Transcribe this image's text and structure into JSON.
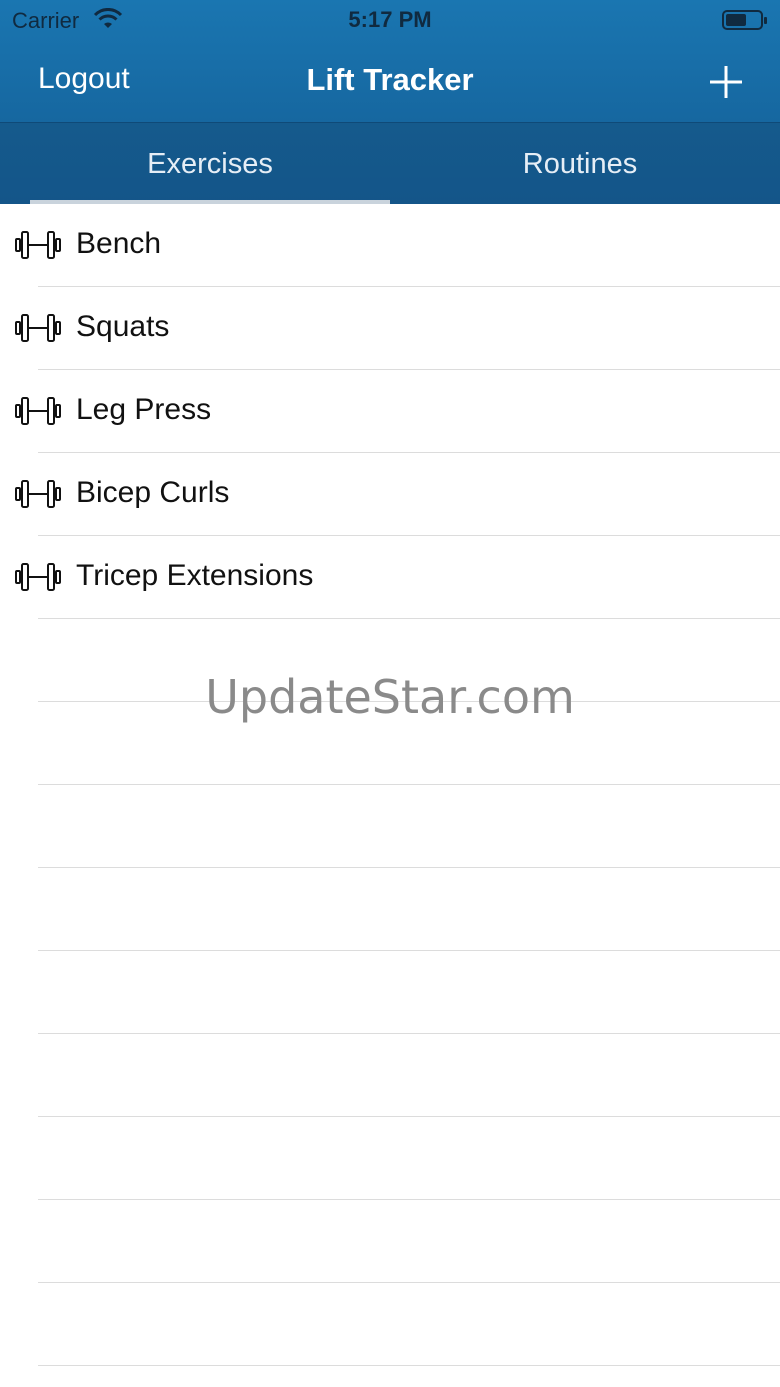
{
  "status_bar": {
    "carrier": "Carrier",
    "time": "5:17 PM",
    "wifi_icon": "wifi-icon",
    "battery_icon": "battery-icon"
  },
  "nav": {
    "left_label": "Logout",
    "title": "Lift Tracker",
    "add_icon": "plus-icon"
  },
  "tabs": [
    {
      "label": "Exercises",
      "active": true
    },
    {
      "label": "Routines",
      "active": false
    }
  ],
  "exercises": [
    {
      "label": "Bench",
      "icon": "dumbbell-icon"
    },
    {
      "label": "Squats",
      "icon": "dumbbell-icon"
    },
    {
      "label": "Leg Press",
      "icon": "dumbbell-icon"
    },
    {
      "label": "Bicep Curls",
      "icon": "dumbbell-icon"
    },
    {
      "label": "Tricep Extensions",
      "icon": "dumbbell-icon"
    }
  ],
  "watermark": "UpdateStar.com",
  "colors": {
    "nav_blue": "#1a76b1",
    "tab_blue": "#155a8c",
    "tab_indicator": "#c9d3dc"
  }
}
